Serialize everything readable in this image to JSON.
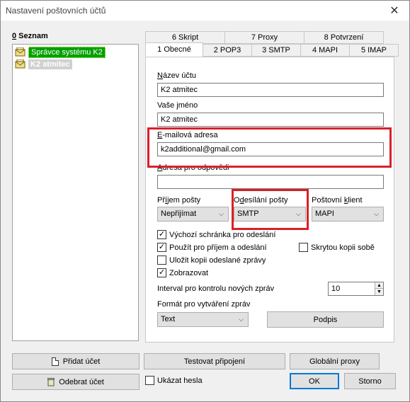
{
  "window": {
    "title": "Nastavení poštovních účtů",
    "close": "✕"
  },
  "list": {
    "heading_key": "0",
    "heading_rest": " Seznam",
    "items": [
      {
        "label": "Správce systému K2"
      },
      {
        "label": "K2 atmitec"
      }
    ]
  },
  "tabs": {
    "row1": [
      "6 Skript",
      "7 Proxy",
      "8 Potvrzení"
    ],
    "row2": [
      "1 Obecné",
      "2 POP3",
      "3 SMTP",
      "4 MAPI",
      "5 IMAP"
    ],
    "active": "1 Obecné"
  },
  "form": {
    "account_name_label_key": "N",
    "account_name_label_rest": "ázev účtu",
    "account_name": "K2 atmitec",
    "your_name_label_pre": "Vaše ",
    "your_name_label_key": "j",
    "your_name_label_rest": "méno",
    "your_name": "K2 atmitec",
    "email_label_key": "E",
    "email_label_rest": "-mailová adresa",
    "email": "k2additional@gmail.com",
    "reply_label_key": "A",
    "reply_label_rest": "dresa pro odpovědi",
    "reply": "",
    "receive_label_pre": "Př",
    "receive_label_key": "í",
    "receive_label_rest": "jem pošty",
    "receive_value": "Nepřijímat",
    "send_label_pre": "O",
    "send_label_key": "d",
    "send_label_rest": "esílání pošty",
    "send_value": "SMTP",
    "client_label_pre": "Poštovní ",
    "client_label_key": "k",
    "client_label_rest": "lient",
    "client_value": "MAPI",
    "chk_default_mailbox": "Výchozí schránka pro odeslání",
    "chk_use_for_receive": "Použít pro příjem a odeslání",
    "chk_hidden_copy": "Skrytou kopii sobě",
    "chk_save_copy": "Uložit kopii odeslané zprávy",
    "chk_display": "Zobrazovat",
    "interval_label": "Interval pro kontrolu nových zpráv",
    "interval_value": "10",
    "format_label": "Formát pro vytváření zpráv",
    "format_value": "Text",
    "signature_button": "Podpis"
  },
  "buttons": {
    "add_account": "Přidat účet",
    "test_connection": "Testovat připojení",
    "global_proxy": "Globální proxy",
    "remove_account": "Odebrat účet",
    "show_password": "Ukázat hesla",
    "ok": "OK",
    "cancel": "Storno"
  },
  "checks": {
    "default_mailbox": true,
    "use_for_receive": true,
    "hidden_copy": false,
    "save_copy": false,
    "display": true,
    "show_password": false
  },
  "colors": {
    "highlight": "#d9202a",
    "selected_item": "#00a000"
  }
}
